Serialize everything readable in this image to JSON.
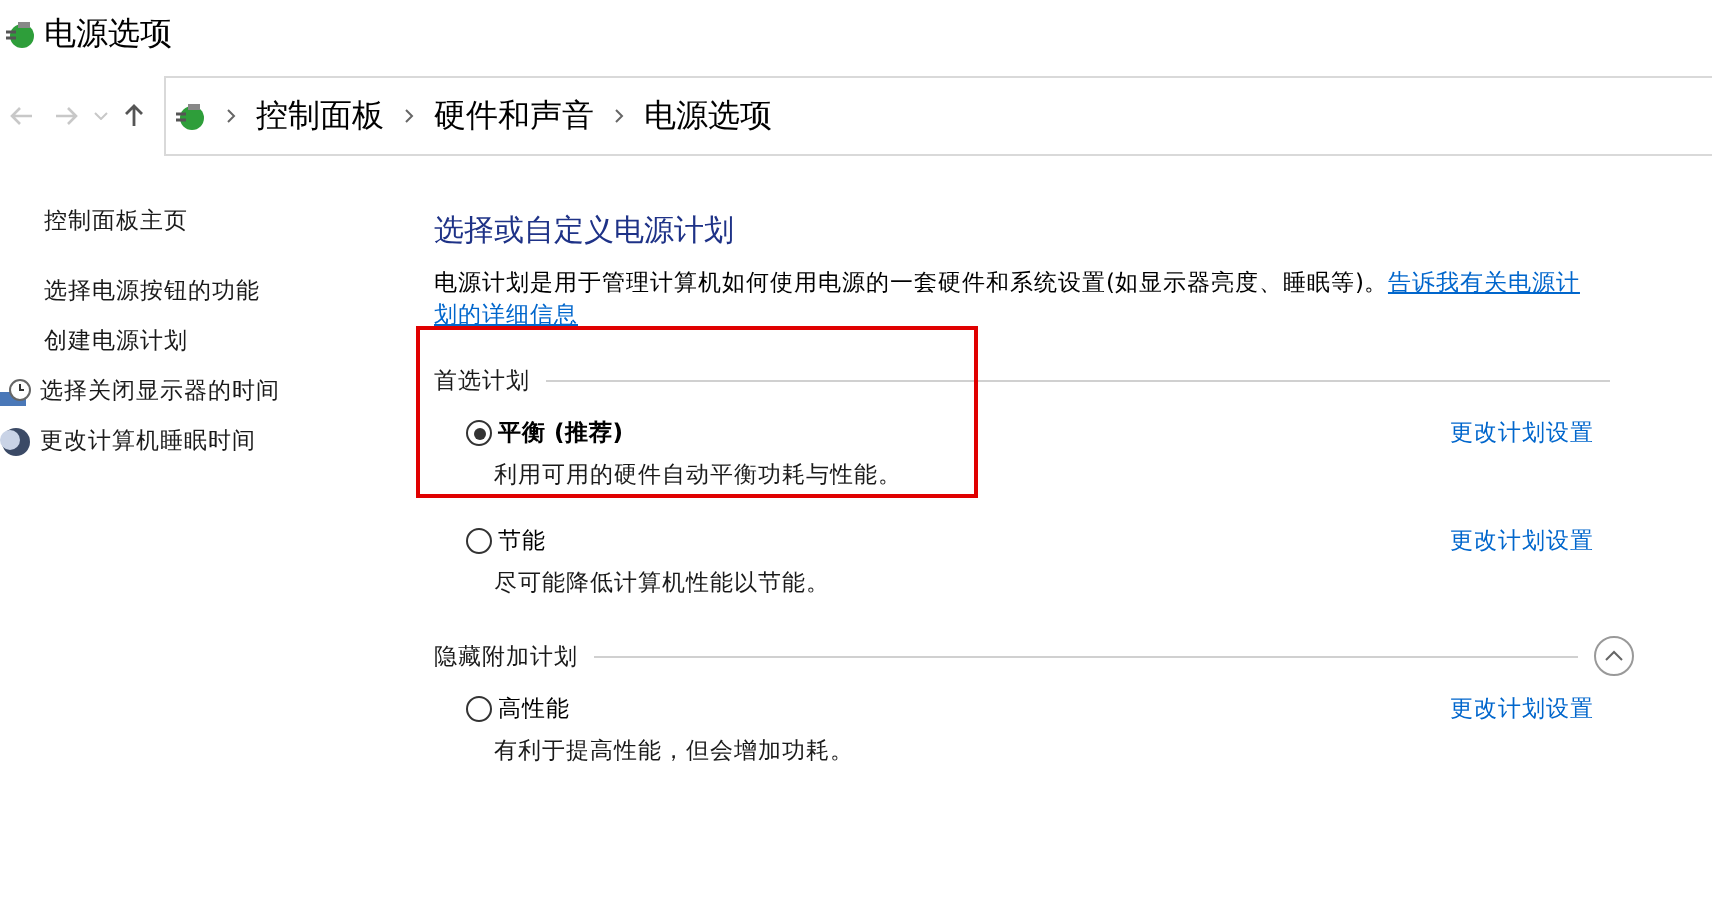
{
  "window": {
    "title": "电源选项"
  },
  "breadcrumb": [
    "控制面板",
    "硬件和声音",
    "电源选项"
  ],
  "sidebar": {
    "items": [
      {
        "label": "控制面板主页",
        "kind": "home"
      },
      {
        "label": "选择电源按钮的功能",
        "kind": "link"
      },
      {
        "label": "创建电源计划",
        "kind": "link"
      },
      {
        "label": "选择关闭显示器的时间",
        "kind": "monitor"
      },
      {
        "label": "更改计算机睡眠时间",
        "kind": "moon"
      }
    ]
  },
  "content": {
    "heading": "选择或自定义电源计划",
    "description": "电源计划是用于管理计算机如何使用电源的一套硬件和系统设置(如显示器亮度、睡眠等)。",
    "learn_more_link": [
      "告诉我有关电源计",
      "划的详细信息"
    ],
    "sections": [
      {
        "title": "首选计划",
        "highlighted": true,
        "plans": [
          {
            "name": "平衡 (推荐)",
            "description": "利用可用的硬件自动平衡功耗与性能。",
            "selected": true,
            "action": "更改计划设置"
          },
          {
            "name": "节能",
            "description": "尽可能降低计算机性能以节能。",
            "selected": false,
            "action": "更改计划设置"
          }
        ]
      },
      {
        "title": "隐藏附加计划",
        "highlighted": false,
        "expanded": true,
        "plans": [
          {
            "name": "高性能",
            "description": "有利于提高性能，但会增加功耗。",
            "selected": false,
            "action": "更改计划设置"
          }
        ]
      }
    ]
  }
}
